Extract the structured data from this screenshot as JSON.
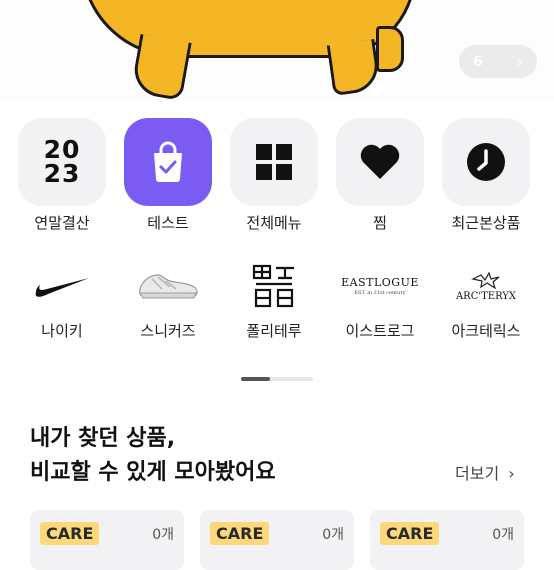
{
  "banner": {
    "slide_counter": "6",
    "next_icon": "chevron-right-icon"
  },
  "menu_row1": [
    {
      "label": "연말결산",
      "icon": "2023-badge-icon",
      "badge_text": [
        "20",
        "23"
      ]
    },
    {
      "label": "테스트",
      "icon": "shopping-bag-check-icon"
    },
    {
      "label": "전체메뉴",
      "icon": "grid-icon"
    },
    {
      "label": "찜",
      "icon": "heart-icon"
    },
    {
      "label": "최근본상품",
      "icon": "clock-icon"
    }
  ],
  "menu_row2": [
    {
      "label": "나이키",
      "icon": "nike-swoosh-icon"
    },
    {
      "label": "스니커즈",
      "icon": "sneaker-icon"
    },
    {
      "label": "폴리테루",
      "icon": "polyteru-logo-icon"
    },
    {
      "label": "이스트로그",
      "icon": "eastlogue-logo-icon",
      "logo_text": "EASTLOGUE",
      "logo_sub": "EST. in 21st century"
    },
    {
      "label": "아크테릭스",
      "icon": "arcteryx-logo-icon",
      "logo_text": "ARC'TERYX"
    }
  ],
  "section": {
    "title_line1": "내가 찾던 상품,",
    "title_line2": "비교할 수 있게 모아봤어요",
    "more_label": "더보기",
    "more_icon": "chevron-right-icon"
  },
  "cards": [
    {
      "badge": "CARE",
      "count": "0개"
    },
    {
      "badge": "CARE",
      "count": "0개"
    },
    {
      "badge": "CARE",
      "count": "0개"
    }
  ],
  "colors": {
    "accent": "#7a5cf2",
    "mascot": "#f5b625",
    "care_badge": "#fbd87a",
    "tile_bg": "#f2f2f4"
  }
}
